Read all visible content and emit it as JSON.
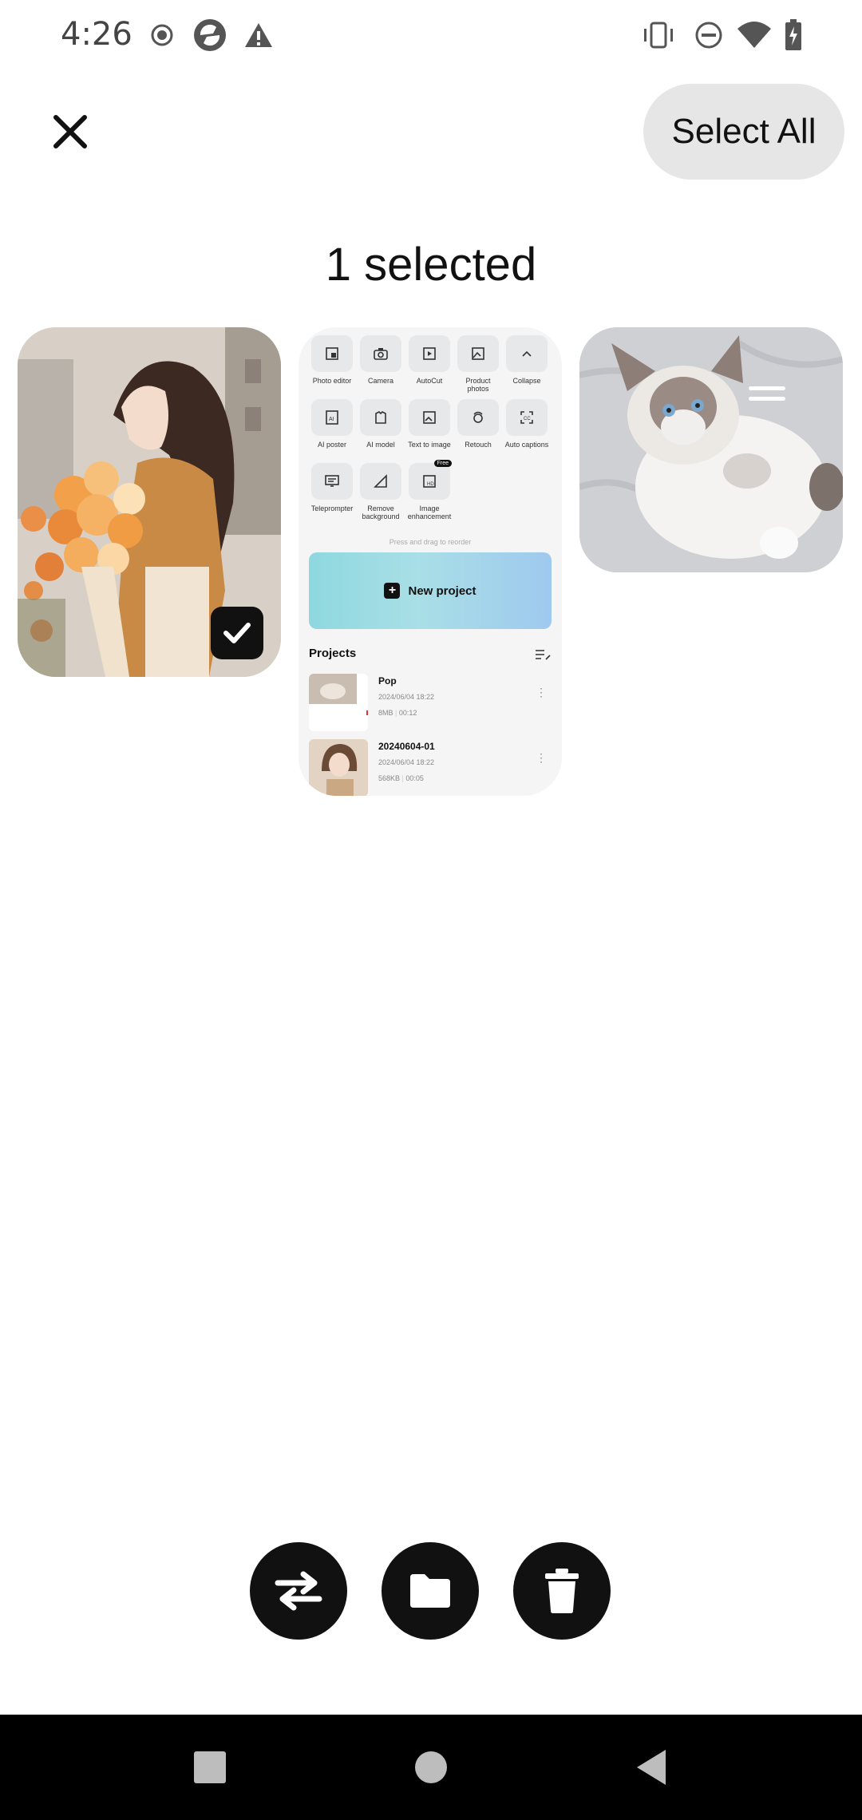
{
  "status_bar": {
    "time": "4:26",
    "left_icons": [
      "record-icon",
      "sync-app-icon",
      "alert-icon"
    ],
    "right_icons": [
      "vibrate-icon",
      "do-not-disturb-icon",
      "wifi-icon",
      "battery-charging-icon"
    ]
  },
  "header": {
    "close_icon": "close-icon",
    "select_all_label": "Select All",
    "title": "1 selected"
  },
  "cards": [
    {
      "name": "anime-girl-flowers",
      "selected": true
    },
    {
      "name": "app-screenshot",
      "selected": false,
      "tools": [
        {
          "label": "Photo editor"
        },
        {
          "label": "Camera"
        },
        {
          "label": "AutoCut"
        },
        {
          "label": "Product photos"
        },
        {
          "label": "Collapse"
        },
        {
          "label": "AI poster"
        },
        {
          "label": "AI model"
        },
        {
          "label": "Text to image"
        },
        {
          "label": "Retouch"
        },
        {
          "label": "Auto captions"
        },
        {
          "label": "Teleprompter"
        },
        {
          "label": "Remove background"
        },
        {
          "label": "Image enhancement"
        }
      ],
      "free_badge": "Free",
      "press_hint": "Press and drag to reorder",
      "new_project_label": "New project",
      "projects_heading": "Projects",
      "projects": [
        {
          "name": "Pop",
          "date": "2024/06/04 18:22",
          "size": "8MB",
          "duration": "00:12"
        },
        {
          "name": "20240604-01",
          "date": "2024/06/04 18:22",
          "size": "568KB",
          "duration": "00:05"
        }
      ]
    },
    {
      "name": "ragdoll-cat",
      "selected": false
    }
  ],
  "actions": [
    "swap-icon",
    "folder-icon",
    "trash-icon"
  ],
  "nav": [
    "recents-square-icon",
    "home-circle-icon",
    "back-triangle-icon"
  ]
}
